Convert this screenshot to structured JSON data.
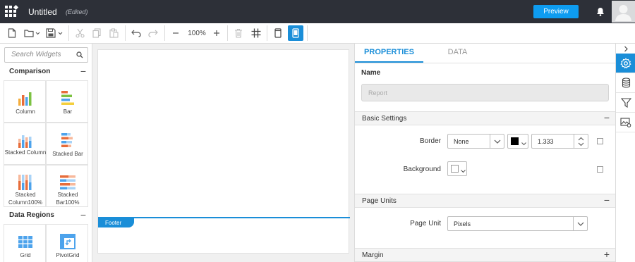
{
  "titlebar": {
    "title": "Untitled",
    "edited": "(Edited)",
    "preview_label": "Preview"
  },
  "toolbar": {
    "zoom": "100%"
  },
  "widgets": {
    "search_placeholder": "Search Widgets",
    "sections": [
      {
        "title": "Comparison",
        "toggle": "−",
        "items": [
          {
            "label": "Column"
          },
          {
            "label": "Bar"
          },
          {
            "label": "Stacked Column"
          },
          {
            "label": "Stacked Bar"
          },
          {
            "label": "Stacked Column100%"
          },
          {
            "label": "Stacked Bar100%"
          }
        ]
      },
      {
        "title": "Data Regions",
        "toggle": "−",
        "items": [
          {
            "label": "Grid"
          },
          {
            "label": "PivotGrid"
          }
        ]
      }
    ]
  },
  "canvas": {
    "footer_label": "Footer"
  },
  "properties": {
    "tabs": [
      {
        "label": "PROPERTIES",
        "active": true
      },
      {
        "label": "DATA",
        "active": false
      }
    ],
    "name_label": "Name",
    "name_placeholder": "Report",
    "sections": {
      "basic": {
        "title": "Basic Settings",
        "toggle": "−"
      },
      "units": {
        "title": "Page Units",
        "toggle": "−"
      },
      "margin": {
        "title": "Margin",
        "toggle": "+"
      }
    },
    "border_label": "Border",
    "border_style": "None",
    "border_color": "#000000",
    "border_width": "1.333",
    "background_label": "Background",
    "page_unit_label": "Page Unit",
    "page_unit": "Pixels"
  },
  "colors": {
    "accent": "#1a8ed8",
    "titlebar": "#2d3038",
    "preview_button": "#0e9cf0"
  }
}
